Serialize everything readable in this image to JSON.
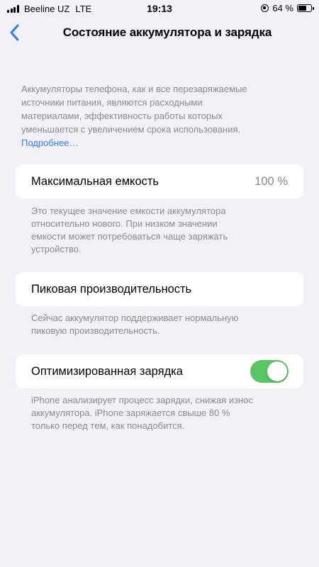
{
  "status_bar": {
    "carrier": "Beeline UZ",
    "network": "LTE",
    "time": "19:13",
    "battery_text": "64 %",
    "battery_level": 0.64
  },
  "nav": {
    "title": "Состояние аккумулятора и зарядка"
  },
  "intro": {
    "line1": "Аккумуляторы телефона, как и все перезаряжаемые",
    "line2": "источники питания, являются расходными",
    "line3": "материалами, эффективность работы которых",
    "line4": "уменьшается с увеличением срока использования.",
    "link": "Подробнее…"
  },
  "max_capacity": {
    "label": "Максимальная емкость",
    "value": "100 %",
    "footnote_line1": "Это текущее значение емкости аккумулятора",
    "footnote_line2": "относительно нового. При низком значении",
    "footnote_line3": "емкости может потребоваться чаще заряжать",
    "footnote_line4": "устройство."
  },
  "peak_performance": {
    "label": "Пиковая производительность",
    "footnote_line1": "Сейчас аккумулятор поддерживает нормальную",
    "footnote_line2": "пиковую производительность."
  },
  "optimized_charging": {
    "label": "Оптимизированная зарядка",
    "enabled": true,
    "footnote_line1": "iPhone анализирует процесс зарядки, снижая износ",
    "footnote_line2": "аккумулятора. iPhone заряжается свыше 80 %",
    "footnote_line3": "только перед тем, как понадобится."
  },
  "colors": {
    "background": "#f2f1f7",
    "accent_link": "#2f7cf6",
    "toggle_on": "#5ac464",
    "secondary_text": "#8a8a8e"
  },
  "icons": {
    "back": "chevron-left-icon",
    "signal": "cellular-signal-icon",
    "rotation_lock": "rotation-lock-icon",
    "battery": "battery-icon"
  }
}
